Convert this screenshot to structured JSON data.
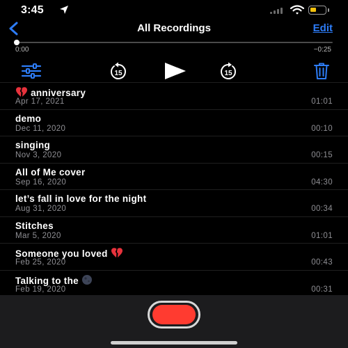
{
  "status": {
    "time": "3:45"
  },
  "nav": {
    "title": "All Recordings",
    "edit_label": "Edit"
  },
  "player": {
    "elapsed": "0:00",
    "remaining": "−0:25",
    "progress": 0,
    "skip_seconds": "15"
  },
  "recordings": [
    {
      "title": "anniversary",
      "date": "Apr 17, 2021",
      "duration": "01:01",
      "emoji_before": "broken-heart"
    },
    {
      "title": "demo",
      "date": "Dec 11, 2020",
      "duration": "00:10"
    },
    {
      "title": "singing",
      "date": "Nov 3, 2020",
      "duration": "00:15"
    },
    {
      "title": "All of Me cover",
      "date": "Sep 16, 2020",
      "duration": "04:30"
    },
    {
      "title": "let’s fall in love for the night",
      "date": "Aug 31, 2020",
      "duration": "00:34"
    },
    {
      "title": "Stitches",
      "date": "Mar 5, 2020",
      "duration": "01:01"
    },
    {
      "title": "Someone you loved",
      "date": "Feb 25, 2020",
      "duration": "00:43",
      "emoji_after": "broken-heart"
    },
    {
      "title": "Talking to the",
      "date": "Feb 19, 2020",
      "duration": "00:31",
      "emoji_after": "moon"
    }
  ],
  "colors": {
    "accent": "#2d7cf6",
    "record": "#ff3b30",
    "secondary_text": "#8e8e93",
    "battery": "#f4c20d"
  }
}
